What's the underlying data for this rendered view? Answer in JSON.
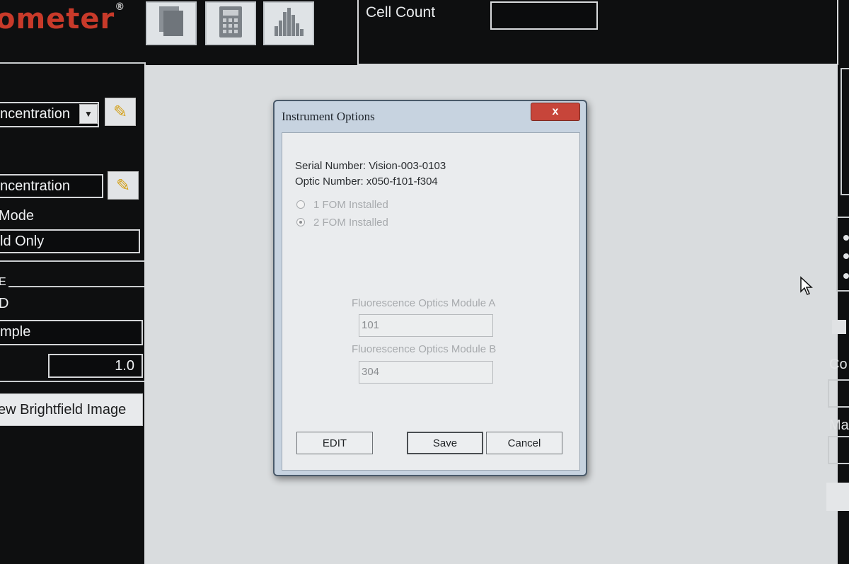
{
  "header": {
    "logo_text": "ometer",
    "logo_mark": "®",
    "toolbar": [
      {
        "name": "documents-icon"
      },
      {
        "name": "calculator-icon"
      },
      {
        "name": "histogram-icon"
      }
    ],
    "cell_count_label": "Cell Count",
    "cell_count_value": ""
  },
  "left_panel": {
    "assay_select": "ncentration",
    "assay_field": "ncentration",
    "mode_label": "Mode",
    "mode_value": "ld Only",
    "group_letter": "E",
    "id_label": "D",
    "sample_value": "mple",
    "dilution_value": "1.0",
    "view_button": "ew Brightfield Image"
  },
  "right_panel": {
    "label_co": "Co",
    "label_ma": "Ma"
  },
  "dialog": {
    "title": "Instrument Options",
    "close_glyph": "x",
    "serial_number": "Serial Number: Vision-003-0103",
    "optic_number": "Optic Number: x050-f101-f304",
    "radio_1": "1 FOM Installed",
    "radio_2": "2 FOM Installed",
    "selected_radio": 2,
    "module_a_label": "Fluorescence Optics Module A",
    "module_a_value": "101",
    "module_b_label": "Fluorescence Optics Module B",
    "module_b_value": "304",
    "edit_button": "EDIT",
    "save_button": "Save",
    "cancel_button": "Cancel"
  },
  "colors": {
    "brand_red": "#c83a2a",
    "app_background": "#0e0f10",
    "main_area": "#d9dcde",
    "dialog_frame": "#c7d3e0",
    "close_button": "#c7453a"
  }
}
